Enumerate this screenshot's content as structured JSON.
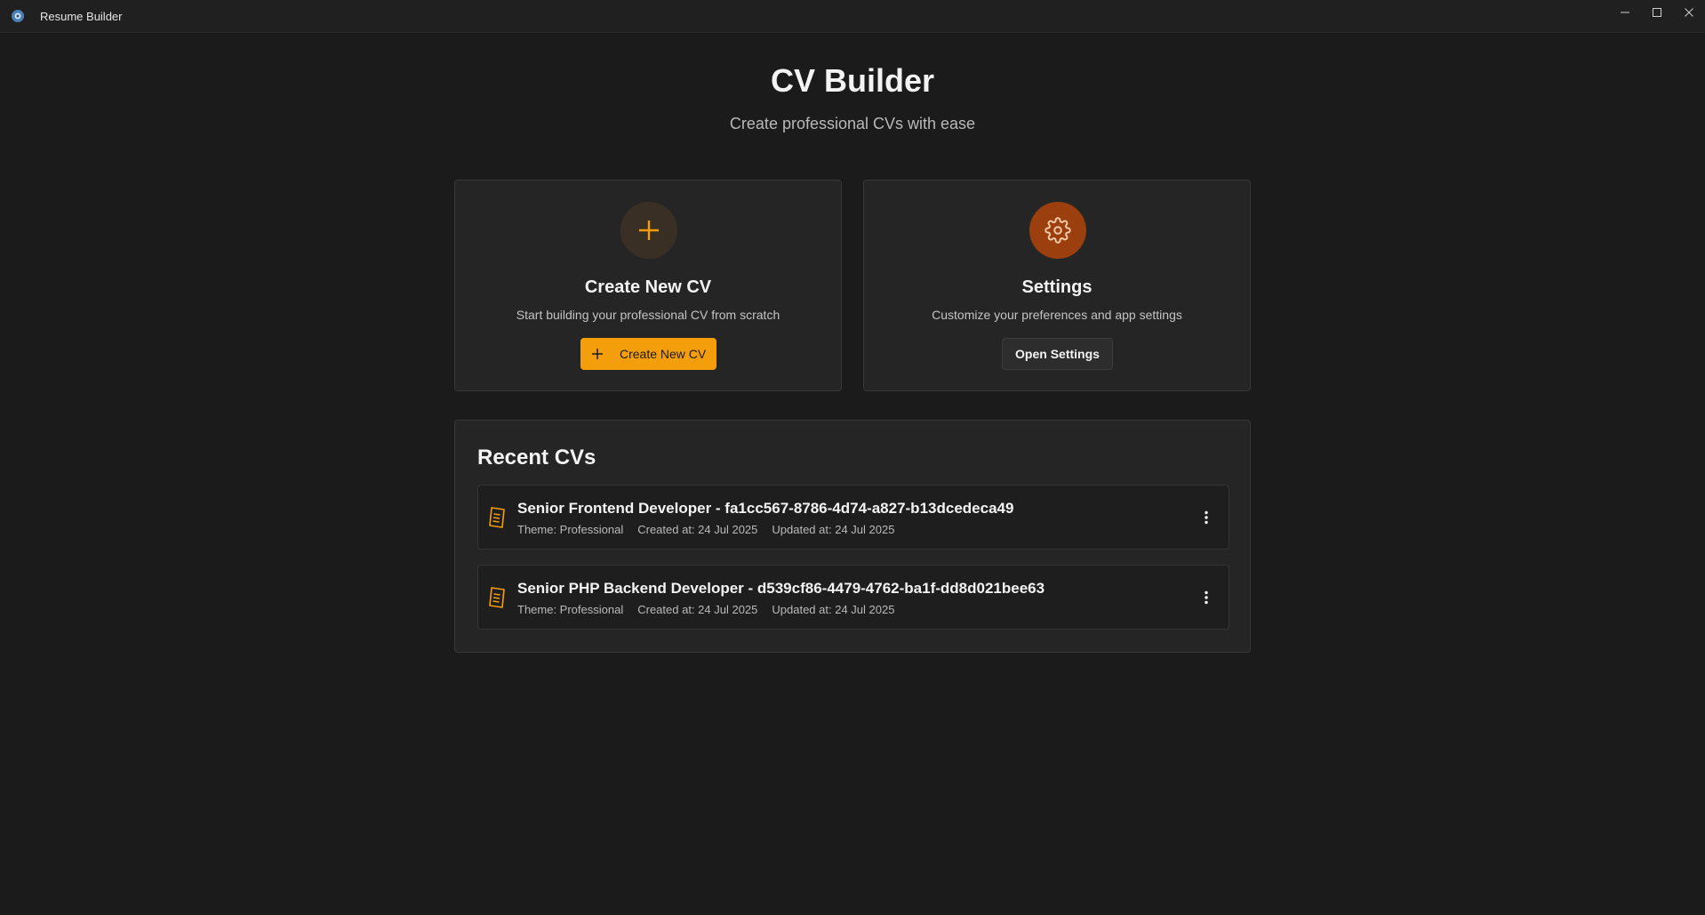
{
  "window": {
    "title": "Resume Builder",
    "controls": [
      "minimize-icon",
      "maximize-icon",
      "close-icon"
    ]
  },
  "header": {
    "title": "CV Builder",
    "subtitle": "Create professional CVs with ease"
  },
  "cards": {
    "create": {
      "icon": "plus-icon",
      "title": "Create New CV",
      "description": "Start building your professional CV from scratch",
      "button_label": "Create New CV"
    },
    "settings": {
      "icon": "gear-icon",
      "title": "Settings",
      "description": "Customize your preferences and app settings",
      "button_label": "Open Settings"
    }
  },
  "recent": {
    "title": "Recent CVs",
    "items": [
      {
        "name": "Senior Frontend Developer - fa1cc567-8786-4d74-a827-b13dcedeca49",
        "theme": "Theme: Professional",
        "created": "Created at: 24 Jul 2025",
        "updated": "Updated at: 24 Jul 2025"
      },
      {
        "name": "Senior PHP Backend Developer - d539cf86-4479-4762-ba1f-dd8d021bee63",
        "theme": "Theme: Professional",
        "created": "Created at: 24 Jul 2025",
        "updated": "Updated at: 24 Jul 2025"
      }
    ]
  },
  "colors": {
    "accent": "#f59e0b",
    "settings_icon_bg": "#9a3f0d",
    "background": "#1b1b1b",
    "card": "#252525"
  }
}
